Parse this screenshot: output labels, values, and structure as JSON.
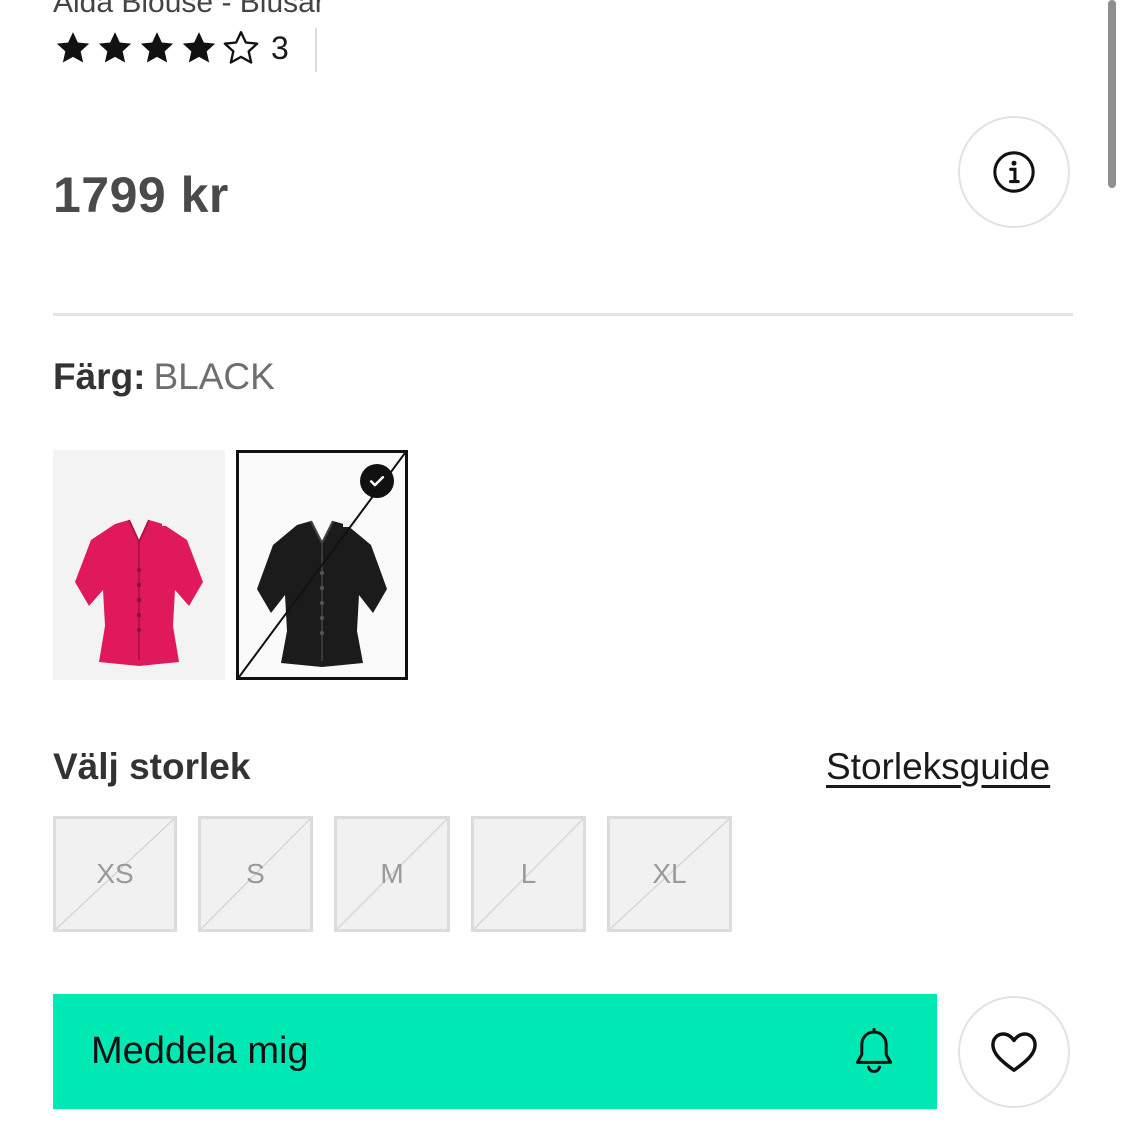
{
  "product": {
    "title": "Aida Blouse - Blusar",
    "rating": 4,
    "rating_max": 5,
    "review_count": "3",
    "price": "1799 kr"
  },
  "color": {
    "label": "Färg:",
    "selected": "BLACK",
    "swatches": [
      {
        "name": "pink",
        "color": "#e0195c",
        "selected": false
      },
      {
        "name": "black",
        "color": "#1b1b1b",
        "selected": true
      }
    ]
  },
  "sizes": {
    "heading": "Välj storlek",
    "guide_link": "Storleksguide",
    "options": [
      "XS",
      "S",
      "M",
      "L",
      "XL"
    ]
  },
  "actions": {
    "notify_label": "Meddela mig"
  },
  "theme": {
    "accent": "#00e8b4"
  }
}
